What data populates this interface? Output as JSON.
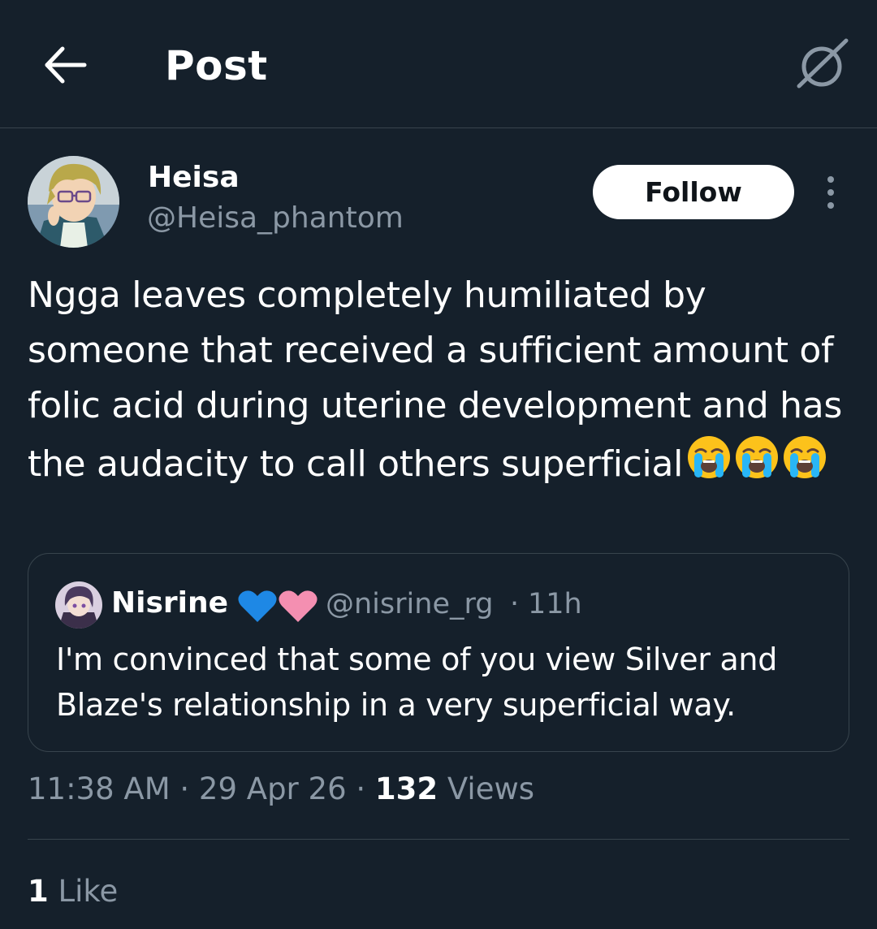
{
  "header": {
    "title": "Post",
    "back_icon": "arrow-left-icon",
    "grok_icon": "grok-icon"
  },
  "post": {
    "author": {
      "display_name": "Heisa",
      "handle": "@Heisa_phantom"
    },
    "follow_label": "Follow",
    "more_icon": "more-vertical-icon",
    "text": "Ngga leaves completely humiliated by someone that received a sufficient amount of folic acid during uterine development and has the audacity to call others superficial",
    "emojis": [
      "loudly-crying-face",
      "loudly-crying-face",
      "loudly-crying-face"
    ],
    "quote": {
      "display_name": "Nisrine",
      "badges": [
        "blue-heart",
        "pink-heart"
      ],
      "handle": "@nisrine_rg",
      "separator": "·",
      "time": "11h",
      "text": "I'm convinced that some of you view Silver and Blaze's relationship in a very superficial way."
    },
    "meta": {
      "time": "11:38 AM",
      "separator": "·",
      "date": "29 Apr 26",
      "views_count": "132",
      "views_label": "Views"
    },
    "likes": {
      "count": "1",
      "label": "Like"
    }
  },
  "colors": {
    "background": "#15202b",
    "divider": "#38444d",
    "secondary_text": "#8b98a5",
    "primary_text": "#ffffff",
    "follow_button_bg": "#ffffff"
  }
}
